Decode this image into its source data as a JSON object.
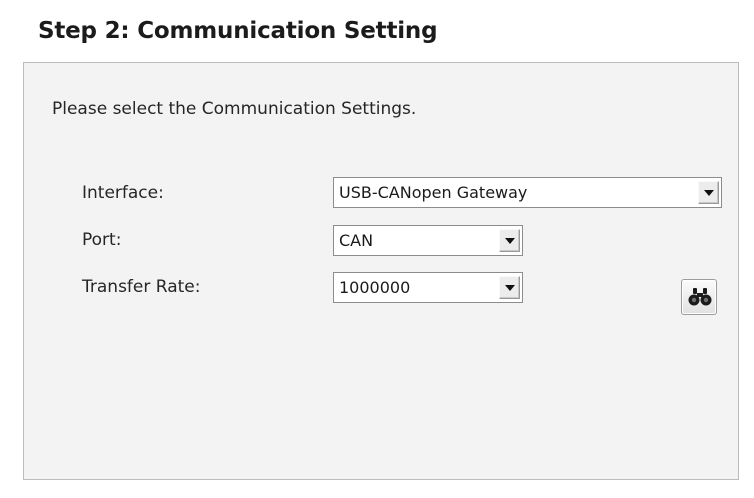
{
  "step": {
    "title": "Step 2: Communication Setting"
  },
  "panel": {
    "instruction": "Please select the Communication Settings.",
    "fields": {
      "interface": {
        "label": "Interface:",
        "value": "USB-CANopen Gateway"
      },
      "port": {
        "label": "Port:",
        "value": "CAN"
      },
      "transfer_rate": {
        "label": "Transfer Rate:",
        "value": "1000000"
      }
    },
    "scan_button": {
      "icon": "binoculars-icon"
    }
  }
}
